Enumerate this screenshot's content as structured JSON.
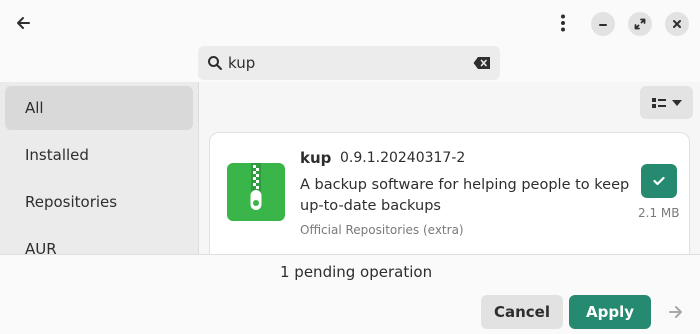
{
  "header": {
    "back_icon": "arrow-left-icon",
    "menu_icon": "kebab-menu-icon",
    "window_controls": [
      "minimize-icon",
      "maximize-icon",
      "close-icon"
    ]
  },
  "search": {
    "value": "kup",
    "placeholder": "",
    "icon": "search-icon",
    "clear_icon": "backspace-clear-icon"
  },
  "sidebar": {
    "items": [
      {
        "label": "All",
        "active": true
      },
      {
        "label": "Installed",
        "active": false
      },
      {
        "label": "Repositories",
        "active": false
      },
      {
        "label": "AUR",
        "active": false
      }
    ]
  },
  "content": {
    "view_toggle_icon": "list-view-icon",
    "package": {
      "name": "kup",
      "version": "0.9.1.20240317-2",
      "description": "A backup software for helping people to keep up-to-date backups",
      "repository": "Official Repositories (extra)",
      "size": "2.1 MB",
      "selected": true,
      "icon": "zip-archive-icon",
      "icon_color": "#39b54a"
    }
  },
  "footer": {
    "pending_text": "1 pending operation",
    "cancel_label": "Cancel",
    "apply_label": "Apply",
    "next_icon": "arrow-right-icon"
  },
  "colors": {
    "accent": "#268a70",
    "sidebar_bg": "#ebebeb",
    "sidebar_active": "#d9d9d9"
  }
}
